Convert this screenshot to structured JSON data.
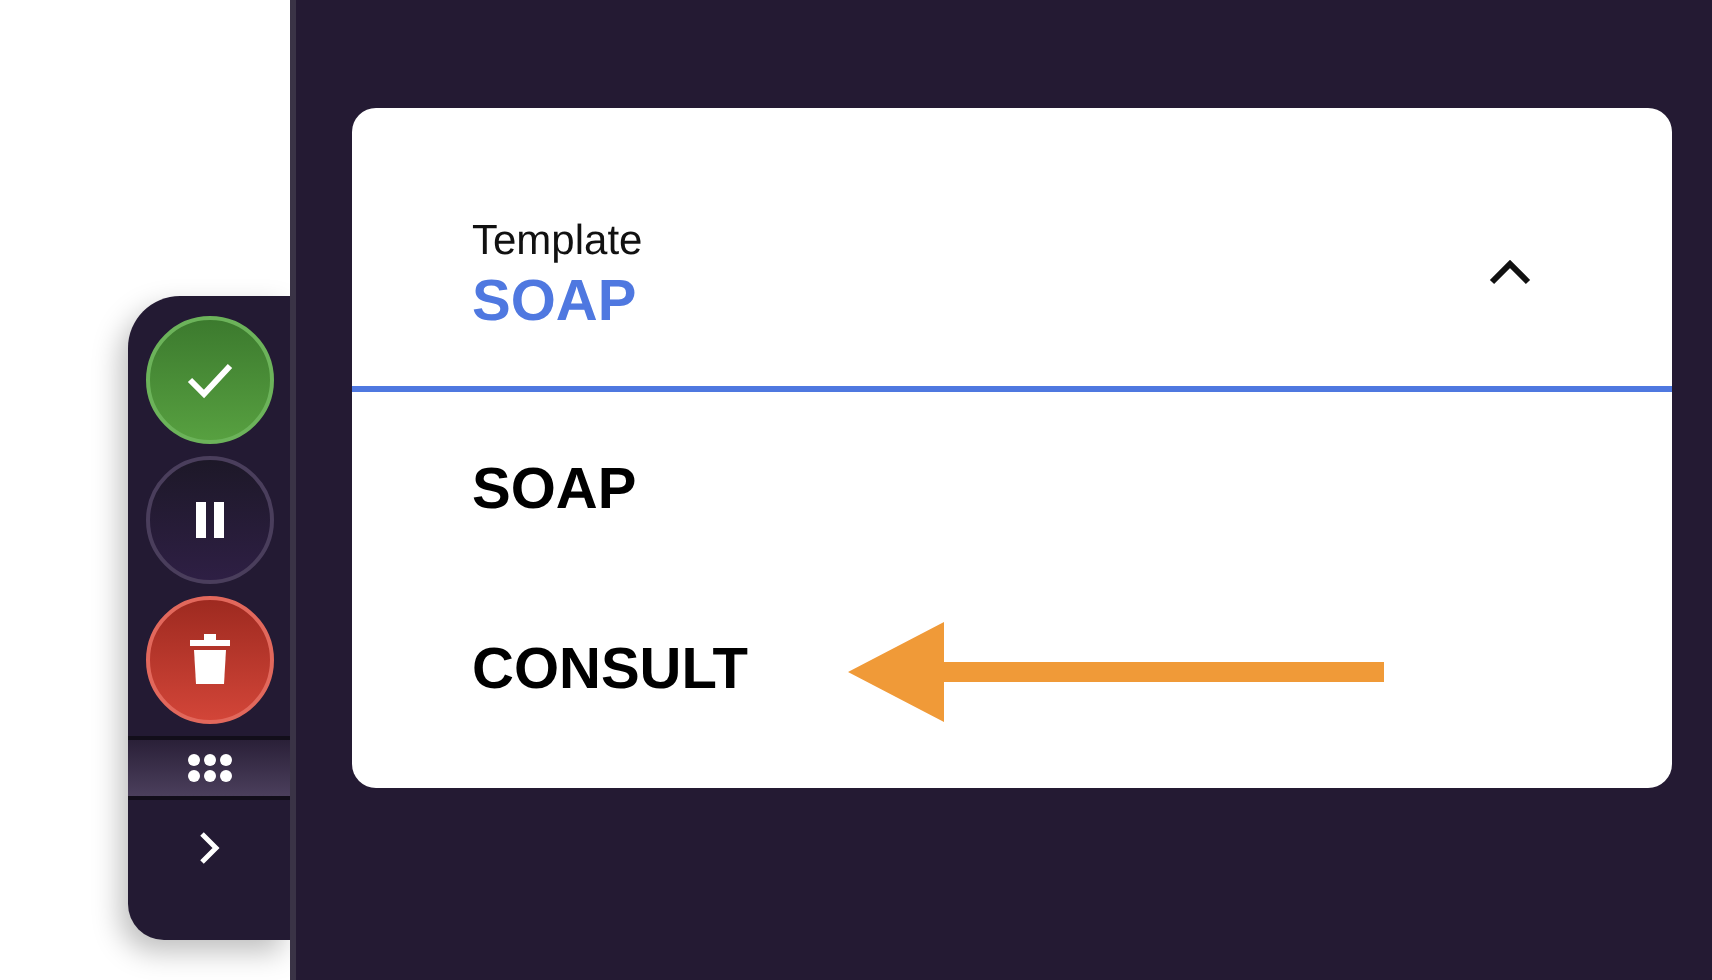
{
  "toolbar": {
    "buttons": [
      {
        "kind": "approve"
      },
      {
        "kind": "pause"
      },
      {
        "kind": "delete"
      }
    ]
  },
  "template_select": {
    "label": "Template",
    "value": "SOAP",
    "expanded": true,
    "options": [
      {
        "label": "SOAP"
      },
      {
        "label": "CONSULT"
      }
    ]
  }
}
